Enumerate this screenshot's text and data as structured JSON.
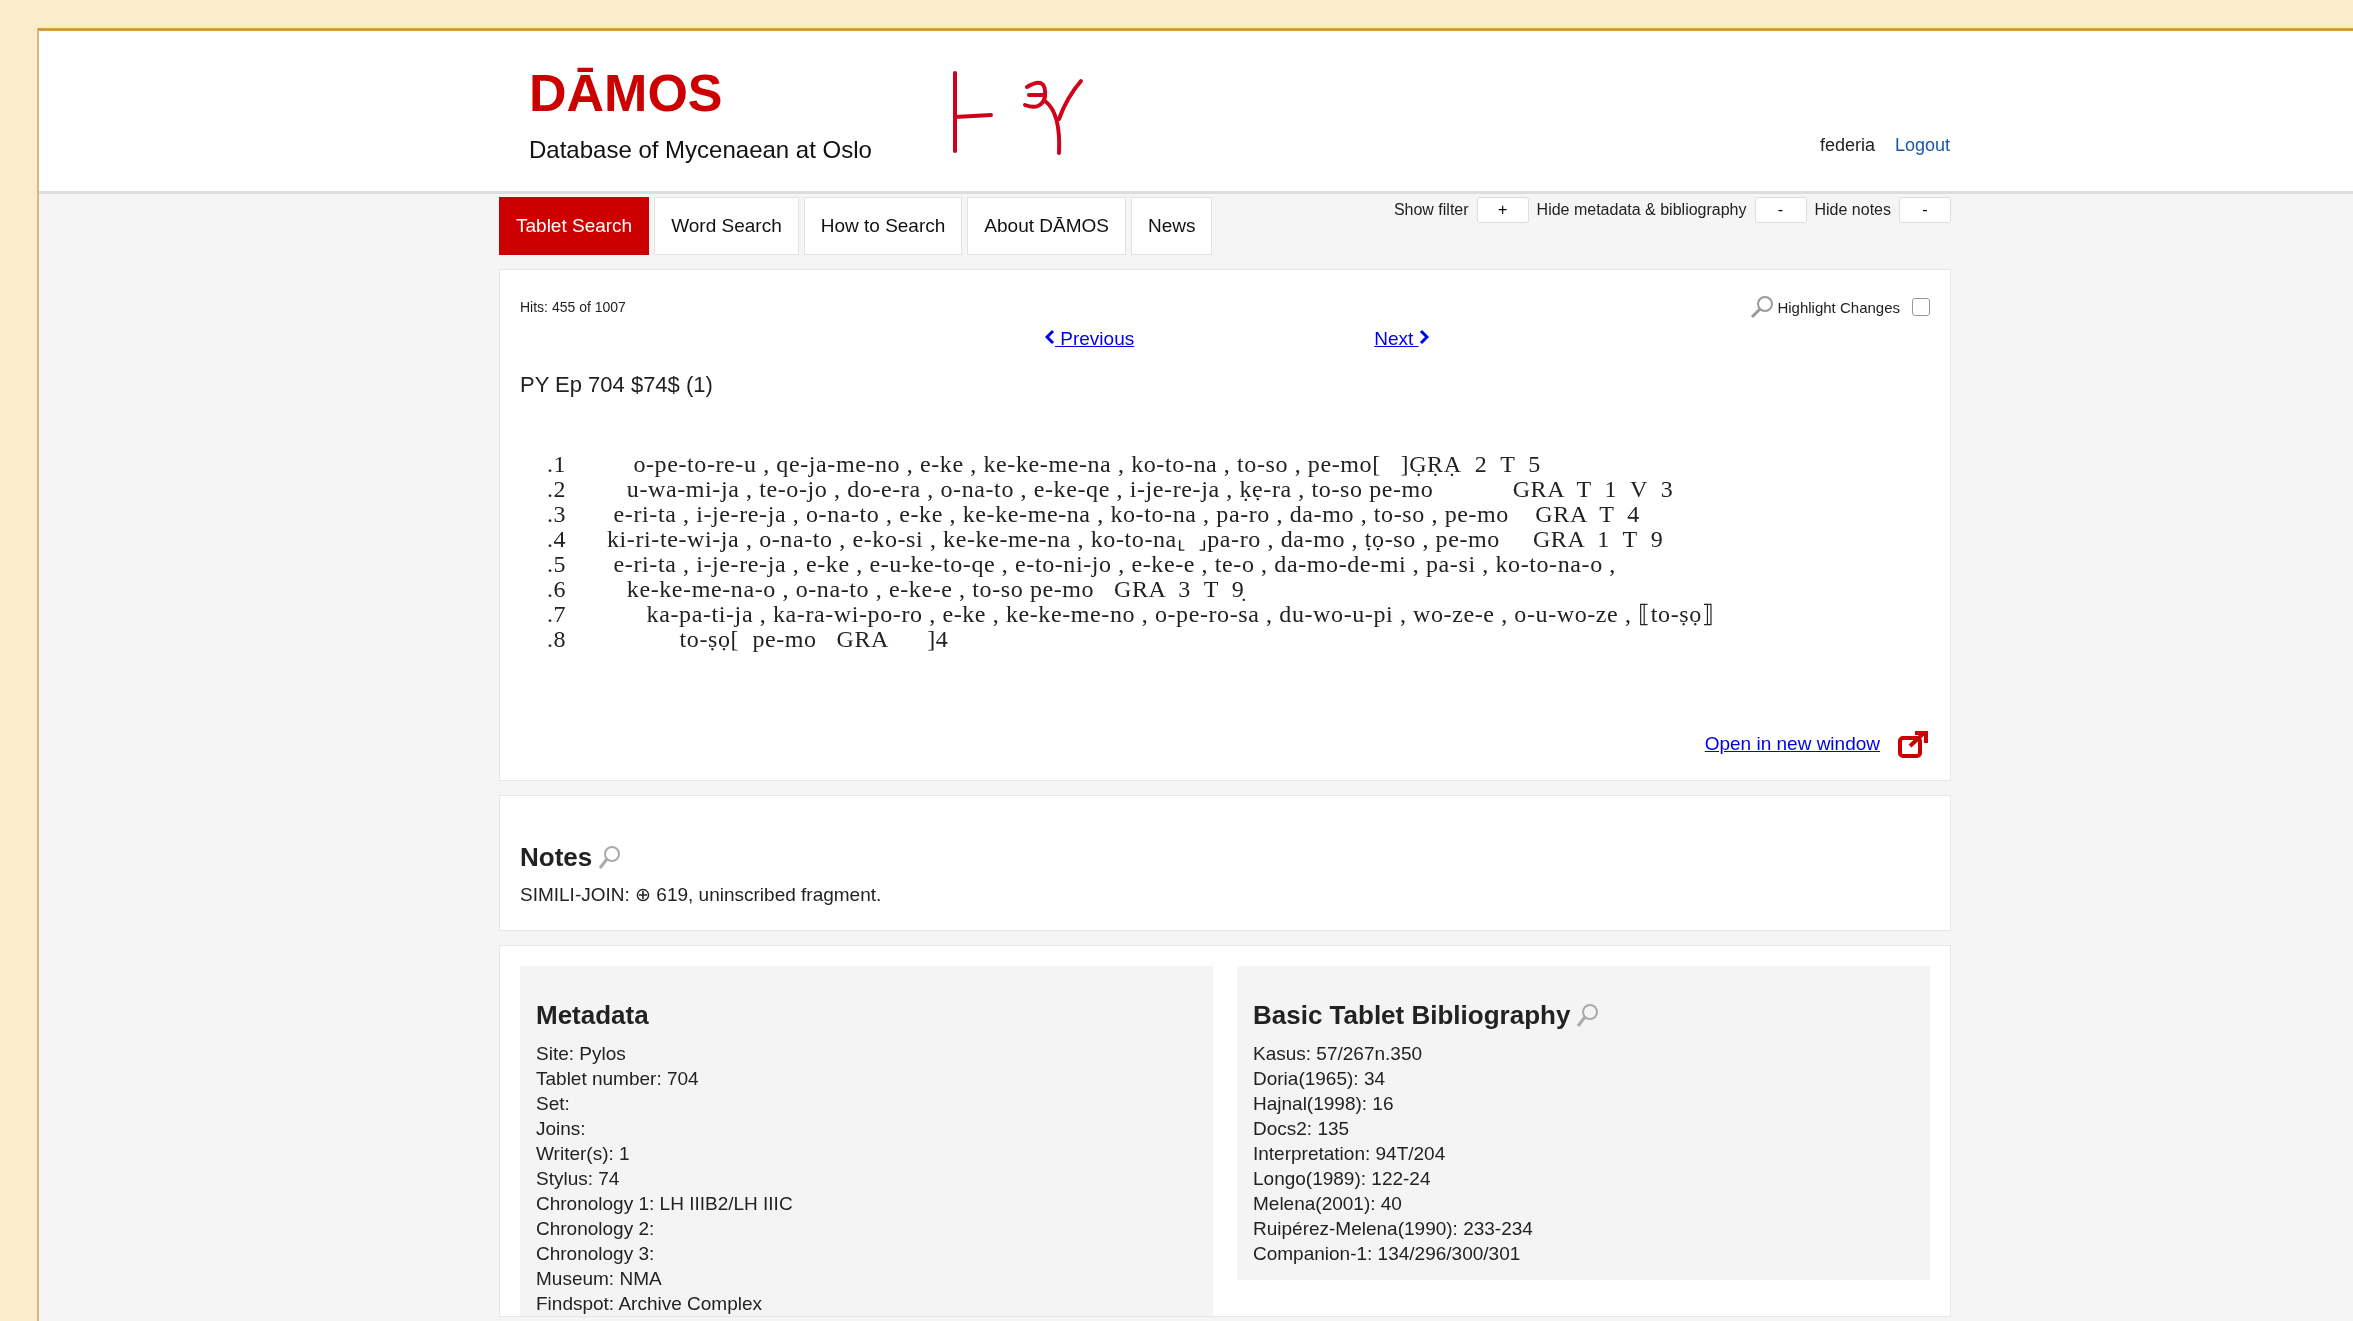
{
  "header": {
    "logo": "DĀMOS",
    "subtitle": "Database of Mycenaean at Oslo",
    "user": "federia",
    "logout": "Logout"
  },
  "tabs": [
    {
      "label": "Tablet Search",
      "selected": true
    },
    {
      "label": "Word Search",
      "selected": false
    },
    {
      "label": "How to Search",
      "selected": false
    },
    {
      "label": "About DĀMOS",
      "selected": false
    },
    {
      "label": "News",
      "selected": false
    }
  ],
  "toggles": [
    {
      "label": "Show filter",
      "button": "+"
    },
    {
      "label": "Hide metadata & bibliography",
      "button": "-"
    },
    {
      "label": "Hide notes",
      "button": "-"
    }
  ],
  "tablet": {
    "hits": "Hits: 455 of 1007",
    "highlight_changes": {
      "label": "Highlight Changes",
      "checked": false
    },
    "previous": "Previous",
    "next": "Next",
    "title": "PY Ep 704 $74$ (1)",
    "lines": [
      {
        "number": ".1",
        "text": "    o-pe-to-re-u , qe-ja-me-no , e-ke , ke-ke-me-na , ko-to-na , to-so , pe-mo[   ]G̣ṚẠ  2  T  5"
      },
      {
        "number": ".2",
        "text": "   u-wa-mi-ja , te-o-jo , do-e-ra , o-na-to , e-ke-qe , i-je-re-ja , ḳẹ-ra , to-so pe-mo            GRA  T  1  V  3"
      },
      {
        "number": ".3",
        "text": " e-ri-ta , i-je-re-ja , o-na-to , e-ke , ke-ke-me-na , ko-to-na , pa-ro , da-mo , to-so , pe-mo    GRA  T  4"
      },
      {
        "number": ".4",
        "text": "ki-ri-te-wi-ja , o-na-to , e-ko-si , ke-ke-me-na , ko-to-na⸤  ⸥pa-ro , da-mo , ṭọ-so , pe-mo     GRA  1  T  9"
      },
      {
        "number": ".5",
        "text": " e-ri-ta , i-je-re-ja , e-ke , e-u-ke-to-qe , e-to-ni-jo , e-ke-e , te-o , da-mo-de-mi , pa-si , ko-to-na-o ,"
      },
      {
        "number": ".6",
        "text": "   ke-ke-me-na-o , o-na-to , e-ke-e , to-so pe-mo   GRA  3  T  9̣"
      },
      {
        "number": ".7",
        "text": "      ka-pa-ti-ja , ka-ra-wi-po-ro , e-ke , ke-ke-me-no , o-pe-ro-sa , du-wo-u-pi , wo-ze-e , o-u-wo-ze , ⟦to-ṣọ⟧"
      },
      {
        "number": ".8",
        "text": "           to-ṣọ[  pe-mo   GRA      ]4"
      }
    ],
    "open_new_window": "Open in new window"
  },
  "notes": {
    "title": "Notes",
    "text": "SIMILI-JOIN: ⊕ 619, uninscribed fragment."
  },
  "metadata": {
    "title": "Metadata",
    "items": [
      "Site: Pylos",
      "Tablet number: 704",
      "Set:",
      "Joins:",
      "Writer(s): 1",
      "Stylus: 74",
      "Chronology 1: LH IIIB2/LH IIIC",
      "Chronology 2:",
      "Chronology 3:",
      "Museum: NMA",
      "Findspot: Archive Complex"
    ]
  },
  "bibliography": {
    "title": "Basic Tablet Bibliography",
    "items": [
      "Kasus: 57/267n.350",
      "Doria(1965): 34",
      "Hajnal(1998): 16",
      "Docs2: 135",
      "Interpretation: 94T/204",
      "Longo(1989): 122-24",
      "Melena(2001): 40",
      "Ruipérez-Melena(1990): 233-234",
      "Companion-1: 134/296/300/301"
    ]
  }
}
